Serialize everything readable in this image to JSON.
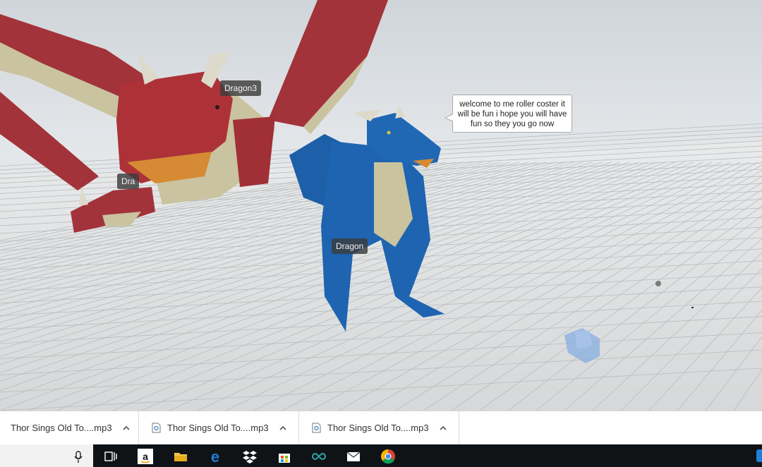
{
  "scene": {
    "labels": {
      "dragon3": "Dragon3",
      "dragon2": "Dra",
      "dragon": "Dragon"
    },
    "speech_bubble": "welcome to me roller coster it will be fun i hope you will have fun  so they you go now"
  },
  "downloads": [
    {
      "name": "Thor Sings Old To....mp3",
      "icon": "file-icon"
    },
    {
      "name": "Thor Sings Old To....mp3",
      "icon": "audio-file-icon"
    },
    {
      "name": "Thor Sings Old To....mp3",
      "icon": "audio-file-icon"
    }
  ],
  "taskbar": {
    "icons": [
      "microphone-icon",
      "task-view-icon",
      "amazon-icon",
      "file-explorer-icon",
      "edge-icon",
      "dropbox-icon",
      "store-icon",
      "arduino-icon",
      "mail-icon",
      "chrome-icon"
    ]
  }
}
